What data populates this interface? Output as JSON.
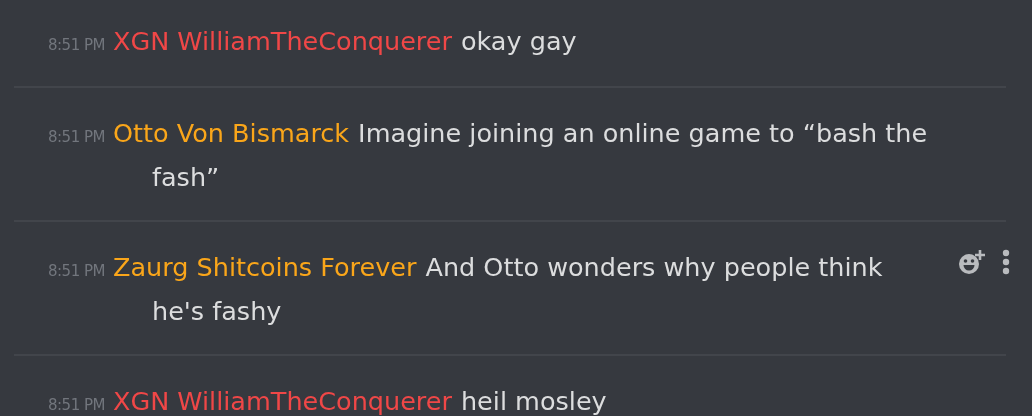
{
  "messages": [
    {
      "time": "8:51 PM",
      "author": "XGN WilliamTheConquerer",
      "color": "#f04747",
      "lines": [
        "okay gay"
      ],
      "hovered": false
    },
    {
      "time": "8:51 PM",
      "author": "Otto Von Bismarck",
      "color": "#faa61a",
      "lines": [
        "Imagine joining an online game to “bash the",
        "fash”"
      ],
      "hovered": false
    },
    {
      "time": "8:51 PM",
      "author": "Zaurg Shitcoins Forever",
      "color": "#faa61a",
      "lines": [
        "And Otto wonders why people think",
        "he's fashy"
      ],
      "hovered": true
    },
    {
      "time": "8:51 PM",
      "author": "XGN WilliamTheConquerer",
      "color": "#f04747",
      "lines": [
        "heil mosley"
      ],
      "hovered": false
    }
  ]
}
